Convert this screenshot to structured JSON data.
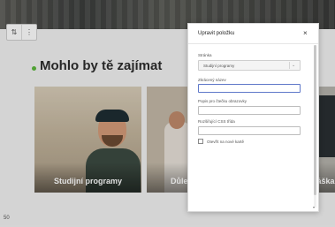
{
  "page": {
    "heading": "Mohlo by tě zajímat",
    "footer_number": "50",
    "cards": [
      {
        "title": "Studijní programy"
      },
      {
        "title": "Důle"
      },
      {
        "title": "láška"
      }
    ],
    "toolbar": {
      "move_icon": "move-icon",
      "more_icon": "more-vertical-icon"
    },
    "accent_color": "#5cb83c"
  },
  "modal": {
    "title": "Upravit položku",
    "close_icon": "close-icon",
    "fields": {
      "page_label": "Stránka",
      "page_value": "Studijní programy",
      "short_name_label": "Zkrácený název",
      "short_name_value": "",
      "desc_label": "Popis pro čtečku obrazovky",
      "desc_value": "",
      "css_label": "Rozšiřující CSS třída",
      "css_value": "",
      "new_tab_label": "Otevřít na nové kartě"
    },
    "focus_color": "#5f78c9"
  }
}
